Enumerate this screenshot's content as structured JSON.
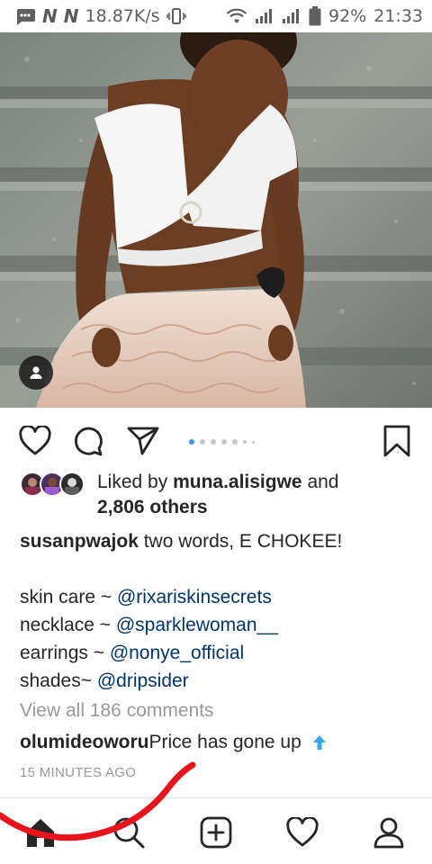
{
  "status_bar": {
    "network_speed": "18.87K/s",
    "battery": "92%",
    "time": "21:33",
    "icons": [
      "message-icon",
      "n-notification-icon",
      "n-notification-icon",
      "vibrate-icon",
      "wifi-icon",
      "signal-icon",
      "signal-icon",
      "battery-icon"
    ]
  },
  "post": {
    "photo_icons": [
      "person-tag-icon"
    ],
    "carousel": {
      "count": 7,
      "active_index": 0
    },
    "actions": [
      "heart-icon",
      "comment-icon",
      "share-icon",
      "bookmark-icon"
    ],
    "likes": {
      "prefix": "Liked by ",
      "user": "muna.alisigwe",
      "middle": " and",
      "others": "2,806 others"
    },
    "caption": {
      "username": "susanpwajok",
      "text": " two words, E CHOKEE!",
      "lines": [
        {
          "prefix": "skin care ~ ",
          "mention": "@rixariskinsecrets"
        },
        {
          "prefix": "necklace ~ ",
          "mention": "@sparklewoman__"
        },
        {
          "prefix": "earrings ~ ",
          "mention": "@nonye_official"
        },
        {
          "prefix": "shades~ ",
          "mention": "@dripsider"
        }
      ]
    },
    "view_comments": "View all 186 comments",
    "comment": {
      "username": "olumideoworu",
      "text": " Price has gone up",
      "emoji": "up-arrow-emoji"
    },
    "timestamp": "15 MINUTES AGO"
  },
  "bottom_nav": [
    "home-icon",
    "search-icon",
    "new-post-icon",
    "activity-heart-icon",
    "profile-icon"
  ],
  "colors": {
    "mention": "#003569",
    "muted": "#999999",
    "carousel_active": "#3897f0",
    "annotation_red": "#e8141b"
  }
}
